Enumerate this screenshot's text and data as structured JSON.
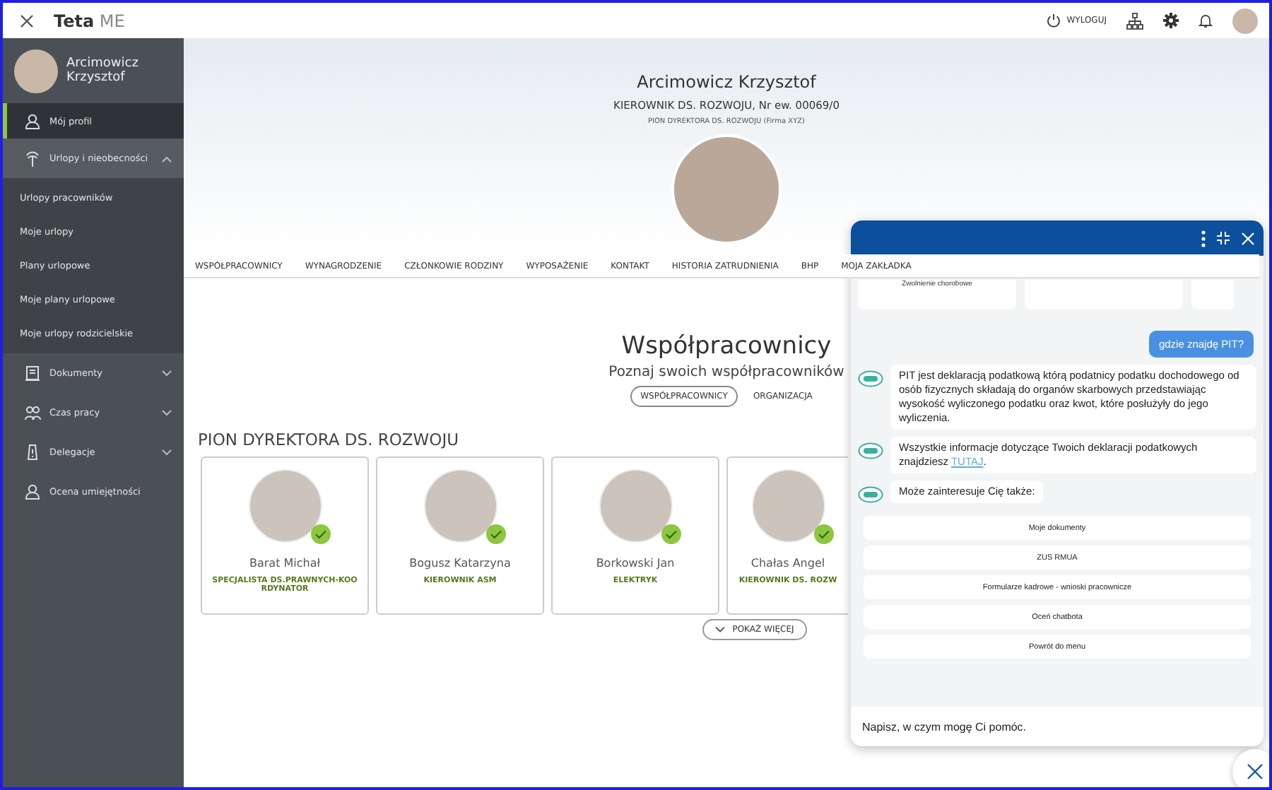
{
  "topbar": {
    "app_title": "**Teta** ME",
    "logout": "WYLOGUJ"
  },
  "sidebar": {
    "user": "Arcimowicz Krzysztof",
    "items": [
      {
        "kind": "link",
        "label": "Mój profil",
        "selected": true
      },
      {
        "kind": "group",
        "label": "Urlopy i nieobecności",
        "expanded": true,
        "selected": false,
        "children": [
          {
            "label": "Urlopy pracowników",
            "selected": false
          },
          {
            "label": "Moje urlopy",
            "selected": false
          },
          {
            "label": "Plany urlopowe",
            "selected": false
          },
          {
            "label": "Moje plany urlopowe",
            "selected": false
          },
          {
            "label": "Moje urlopy rodzicielskie",
            "selected": false
          }
        ]
      },
      {
        "kind": "group",
        "label": "Dokumenty",
        "expanded": false,
        "selected": false
      },
      {
        "kind": "group",
        "label": "Czas pracy",
        "expanded": false,
        "selected": false
      },
      {
        "kind": "group",
        "label": "Delegacje",
        "expanded": false,
        "selected": false
      },
      {
        "kind": "link",
        "label": "Ocena umiejętności",
        "selected": false
      }
    ]
  },
  "profile": {
    "name": "Arcimowicz Krzysztof",
    "position": "KIEROWNIK DS. ROZWOJU, Nr ew. 00069/0",
    "unit": "PION DYREKTORA DS. ROZWOJU (Firma XYZ)"
  },
  "tabs": [
    "WSPÓŁPRACOWNICY",
    "WYNAGRODZENIE",
    "CZŁONKOWIE RODZINY",
    "WYPOSAŻENIE",
    "KONTAKT",
    "HISTORIA ZATRUDNIENIA",
    "BHP",
    "MOJA ZAKŁADKA"
  ],
  "section": {
    "title": "Współpracownicy",
    "subtitle": "Poznaj swoich współpracowników",
    "subtabs": [
      {
        "label": "WSPÓŁPRACOWNICY",
        "selected": true
      },
      {
        "label": "ORGANIZACJA",
        "selected": false
      }
    ],
    "group_title": "PION DYREKTORA DS. ROZWOJU",
    "people": [
      {
        "name": "Barat Michał",
        "role": "SPECJALISTA DS.PRAWNYCH-KOORDYNATOR",
        "verified": true
      },
      {
        "name": "Bogusz Katarzyna",
        "role": "KIEROWNIK ASM",
        "verified": true
      },
      {
        "name": "Borkowski Jan",
        "role": "ELEKTRYK",
        "verified": true
      },
      {
        "name": "Chałas Angel",
        "role": "KIEROWNIK DS. ROZW",
        "verified": true
      }
    ],
    "more": "POKAŻ WIĘCEJ"
  },
  "chat": {
    "top_cards": [
      {
        "kind": "labeled",
        "label": "Zwolnienie chorobowe"
      },
      {
        "kind": "blank"
      },
      {
        "kind": "blank"
      }
    ],
    "messages": [
      {
        "kind": "user",
        "text": "gdzie znajdę PIT?"
      },
      {
        "kind": "bot",
        "text": "PIT jest deklaracją podatkową którą podatnicy podatku dochodowego od osób fizycznych składają do organów skarbowych przedstawiając wysokość wyliczonego podatku oraz kwot, które posłużyły do jego wyliczenia."
      },
      {
        "kind": "bot",
        "text": "Wszystkie informacje dotyczące Twoich deklaracji podatkowych znajdziesz ",
        "link": "TUTAJ",
        "after": "."
      },
      {
        "kind": "bot",
        "text": "Może zainteresuje Cię także:"
      }
    ],
    "suggestions": [
      "Moje dokumenty",
      "ZUS RMUA",
      "Formularze kadrowe - wnioski pracownicze",
      "Oceń chatbota",
      "Powrót do menu"
    ],
    "placeholder": "Napisz, w czym mogę Ci pomóc."
  }
}
